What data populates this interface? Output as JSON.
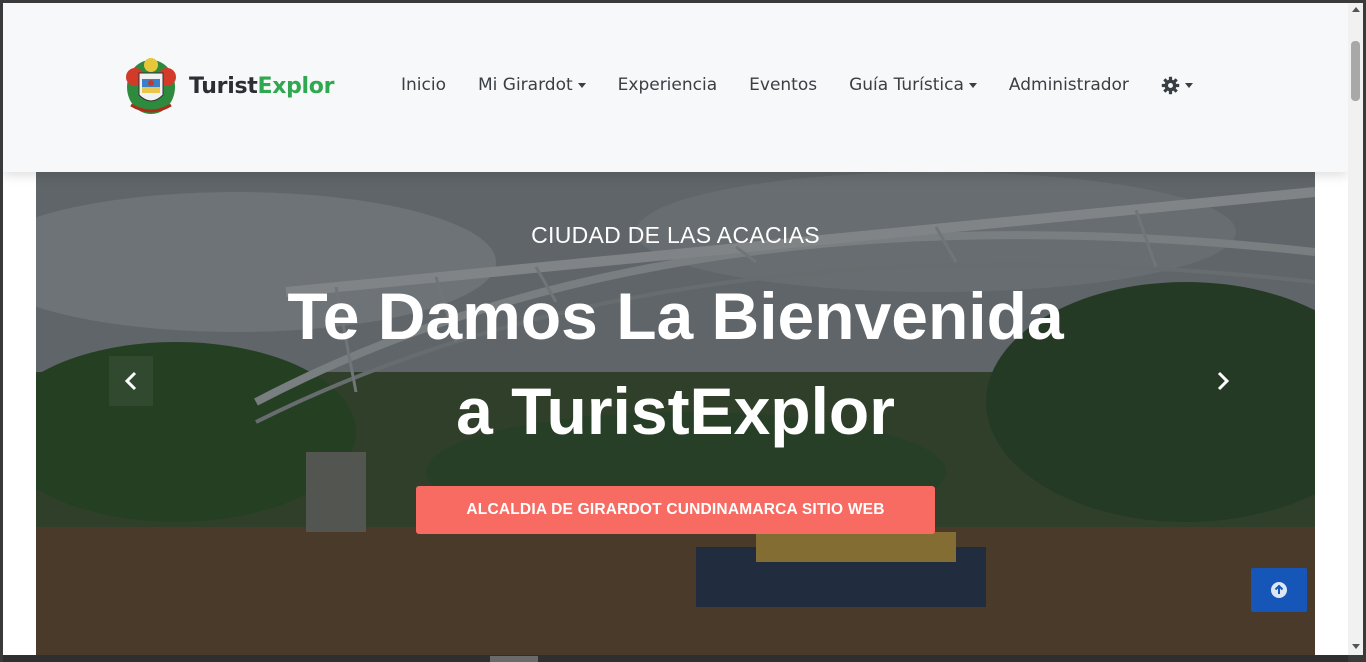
{
  "brand": {
    "name_part1": "Turist",
    "name_part2": "Explor"
  },
  "nav": {
    "items": [
      {
        "label": "Inicio",
        "dropdown": false
      },
      {
        "label": "Mi Girardot",
        "dropdown": true
      },
      {
        "label": "Experiencia",
        "dropdown": false
      },
      {
        "label": "Eventos",
        "dropdown": false
      },
      {
        "label": "Guía Turística",
        "dropdown": true
      },
      {
        "label": "Administrador",
        "dropdown": false
      }
    ],
    "settings_icon": "gear-icon"
  },
  "hero": {
    "subtitle": "CIUDAD DE LAS ACACIAS",
    "headline_line1": "Te Damos La Bienvenida",
    "headline_line2": "a TuristExplor",
    "cta_label": "ALCALDIA DE GIRARDOT CUNDINAMARCA SITIO WEB",
    "prev_icon": "chevron-left-icon",
    "next_icon": "chevron-right-icon"
  },
  "back_to_top_icon": "arrow-up-circle-icon",
  "colors": {
    "brand_green": "#2fa84f",
    "cta": "#f76b63",
    "back_to_top": "#1656b8",
    "navbar_bg": "#f7f8fa"
  }
}
